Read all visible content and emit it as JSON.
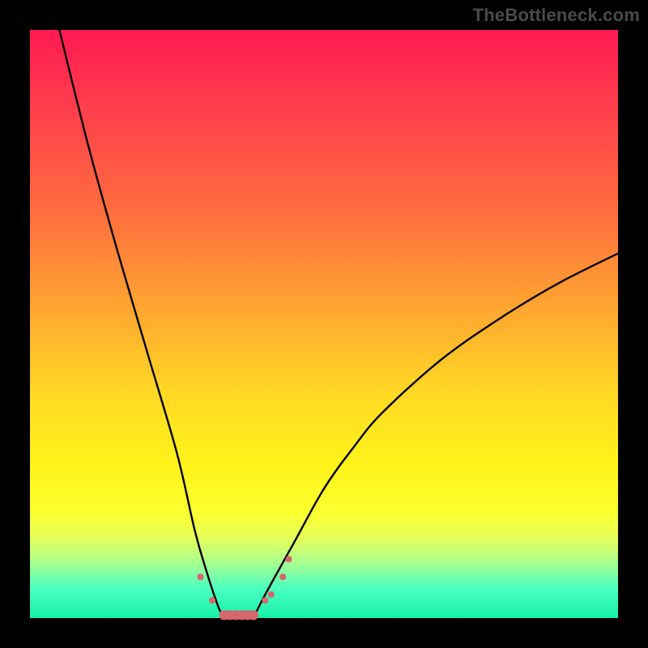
{
  "watermark": "TheBottleneck.com",
  "colors": {
    "frame": "#000000",
    "curve": "#000000",
    "marker": "#d6676d",
    "gradient_stops": [
      "#ff1a52",
      "#ff3b4d",
      "#ff6a3f",
      "#ffa830",
      "#ffd924",
      "#fff31a",
      "#fcff2f",
      "#e8ff55",
      "#c3ff7a",
      "#8cffa0",
      "#4affc0",
      "#16f1a8"
    ]
  },
  "chart_data": {
    "type": "line",
    "title": "",
    "xlabel": "",
    "ylabel": "",
    "xlim": [
      0,
      100
    ],
    "ylim": [
      0,
      100
    ],
    "grid": false,
    "notes": "V-shaped bottleneck curve; minimum ≈0 around x≈33–38; left branch rises to ≈100 at x≈5; right branch rises to ≈62 at x≈100.",
    "series": [
      {
        "name": "left-branch",
        "x": [
          5,
          10,
          15,
          20,
          25,
          28,
          30,
          32,
          33
        ],
        "values": [
          100,
          80,
          62,
          45,
          28,
          15,
          8,
          2,
          0
        ]
      },
      {
        "name": "right-branch",
        "x": [
          38,
          40,
          45,
          50,
          55,
          60,
          70,
          80,
          90,
          100
        ],
        "values": [
          0,
          4,
          13,
          22,
          29,
          35,
          44,
          51,
          57,
          62
        ]
      },
      {
        "name": "markers",
        "x": [
          29,
          31,
          33,
          34,
          35,
          36,
          37,
          38,
          40,
          41,
          43,
          44
        ],
        "values": [
          7,
          3,
          0.5,
          0.5,
          0.5,
          0.5,
          0.5,
          0.5,
          3,
          4,
          7,
          10
        ]
      }
    ]
  }
}
